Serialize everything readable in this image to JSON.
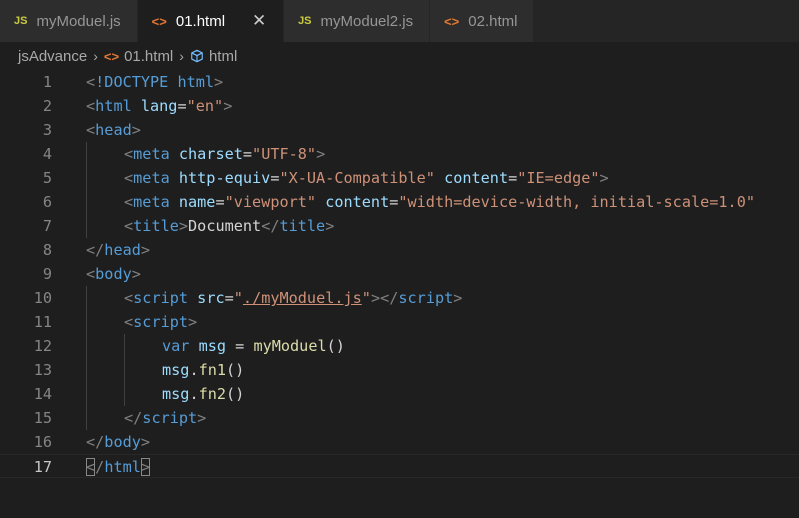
{
  "tabs": [
    {
      "label": "myModuel.js",
      "icon": "JS",
      "type": "js",
      "active": false
    },
    {
      "label": "01.html",
      "icon": "<>",
      "type": "html",
      "active": true,
      "close": "✕"
    },
    {
      "label": "myModuel2.js",
      "icon": "JS",
      "type": "js",
      "active": false
    },
    {
      "label": "02.html",
      "icon": "<>",
      "type": "html",
      "active": false
    }
  ],
  "breadcrumb": {
    "folder": "jsAdvance",
    "file": "01.html",
    "file_icon": "<>",
    "symbol": "html"
  },
  "editor": {
    "current_line": 17,
    "lines": [
      {
        "n": "1",
        "indent": 0,
        "tokens": [
          [
            "t-punc",
            "<"
          ],
          [
            "t-tag",
            "!DOCTYPE "
          ],
          [
            "t-tag",
            "html"
          ],
          [
            "t-punc",
            ">"
          ]
        ]
      },
      {
        "n": "2",
        "indent": 0,
        "tokens": [
          [
            "t-punc",
            "<"
          ],
          [
            "t-tag",
            "html "
          ],
          [
            "t-attr",
            "lang"
          ],
          [
            "t-text",
            "="
          ],
          [
            "t-str",
            "\"en\""
          ],
          [
            "t-punc",
            ">"
          ]
        ]
      },
      {
        "n": "3",
        "indent": 0,
        "tokens": [
          [
            "t-punc",
            "<"
          ],
          [
            "t-tag",
            "head"
          ],
          [
            "t-punc",
            ">"
          ]
        ]
      },
      {
        "n": "4",
        "indent": 1,
        "tokens": [
          [
            "t-punc",
            "<"
          ],
          [
            "t-tag",
            "meta "
          ],
          [
            "t-attr",
            "charset"
          ],
          [
            "t-text",
            "="
          ],
          [
            "t-str",
            "\"UTF-8\""
          ],
          [
            "t-punc",
            ">"
          ]
        ]
      },
      {
        "n": "5",
        "indent": 1,
        "tokens": [
          [
            "t-punc",
            "<"
          ],
          [
            "t-tag",
            "meta "
          ],
          [
            "t-attr",
            "http-equiv"
          ],
          [
            "t-text",
            "="
          ],
          [
            "t-str",
            "\"X-UA-Compatible\""
          ],
          [
            "t-text",
            " "
          ],
          [
            "t-attr",
            "content"
          ],
          [
            "t-text",
            "="
          ],
          [
            "t-str",
            "\"IE=edge\""
          ],
          [
            "t-punc",
            ">"
          ]
        ]
      },
      {
        "n": "6",
        "indent": 1,
        "tokens": [
          [
            "t-punc",
            "<"
          ],
          [
            "t-tag",
            "meta "
          ],
          [
            "t-attr",
            "name"
          ],
          [
            "t-text",
            "="
          ],
          [
            "t-str",
            "\"viewport\""
          ],
          [
            "t-text",
            " "
          ],
          [
            "t-attr",
            "content"
          ],
          [
            "t-text",
            "="
          ],
          [
            "t-str",
            "\"width=device-width, initial-scale=1.0\""
          ]
        ]
      },
      {
        "n": "7",
        "indent": 1,
        "tokens": [
          [
            "t-punc",
            "<"
          ],
          [
            "t-tag",
            "title"
          ],
          [
            "t-punc",
            ">"
          ],
          [
            "t-text",
            "Document"
          ],
          [
            "t-punc",
            "</"
          ],
          [
            "t-tag",
            "title"
          ],
          [
            "t-punc",
            ">"
          ]
        ]
      },
      {
        "n": "8",
        "indent": 0,
        "tokens": [
          [
            "t-punc",
            "</"
          ],
          [
            "t-tag",
            "head"
          ],
          [
            "t-punc",
            ">"
          ]
        ]
      },
      {
        "n": "9",
        "indent": 0,
        "tokens": [
          [
            "t-punc",
            "<"
          ],
          [
            "t-tag",
            "body"
          ],
          [
            "t-punc",
            ">"
          ]
        ]
      },
      {
        "n": "10",
        "indent": 1,
        "tokens": [
          [
            "t-punc",
            "<"
          ],
          [
            "t-tag",
            "script "
          ],
          [
            "t-attr",
            "src"
          ],
          [
            "t-text",
            "="
          ],
          [
            "t-str",
            "\""
          ],
          [
            "t-str t-link",
            "./myModuel.js"
          ],
          [
            "t-str",
            "\""
          ],
          [
            "t-punc",
            "></"
          ],
          [
            "t-tag",
            "script"
          ],
          [
            "t-punc",
            ">"
          ]
        ]
      },
      {
        "n": "11",
        "indent": 1,
        "tokens": [
          [
            "t-punc",
            "<"
          ],
          [
            "t-tag",
            "script"
          ],
          [
            "t-punc",
            ">"
          ]
        ]
      },
      {
        "n": "12",
        "indent": 2,
        "tokens": [
          [
            "t-kw",
            "var "
          ],
          [
            "t-var",
            "msg"
          ],
          [
            "t-text",
            " = "
          ],
          [
            "t-fn",
            "myModuel"
          ],
          [
            "t-text",
            "()"
          ]
        ]
      },
      {
        "n": "13",
        "indent": 2,
        "tokens": [
          [
            "t-var",
            "msg"
          ],
          [
            "t-text",
            "."
          ],
          [
            "t-fn",
            "fn1"
          ],
          [
            "t-text",
            "()"
          ]
        ]
      },
      {
        "n": "14",
        "indent": 2,
        "tokens": [
          [
            "t-var",
            "msg"
          ],
          [
            "t-text",
            "."
          ],
          [
            "t-fn",
            "fn2"
          ],
          [
            "t-text",
            "()"
          ]
        ]
      },
      {
        "n": "15",
        "indent": 1,
        "tokens": [
          [
            "t-punc",
            "</"
          ],
          [
            "t-tag",
            "script"
          ],
          [
            "t-punc",
            ">"
          ]
        ]
      },
      {
        "n": "16",
        "indent": 0,
        "tokens": [
          [
            "t-punc",
            "</"
          ],
          [
            "t-tag",
            "body"
          ],
          [
            "t-punc",
            ">"
          ]
        ]
      },
      {
        "n": "17",
        "indent": 0,
        "tokens": [
          [
            "t-punc t-match",
            "<"
          ],
          [
            "t-punc",
            "/"
          ],
          [
            "t-tag",
            "html"
          ],
          [
            "t-punc t-match",
            ">"
          ]
        ]
      }
    ]
  },
  "colors": {
    "background": "#1e1e1e",
    "tag": "#569cd6",
    "attribute": "#9cdcfe",
    "string": "#ce9178",
    "function": "#dcdcaa"
  }
}
